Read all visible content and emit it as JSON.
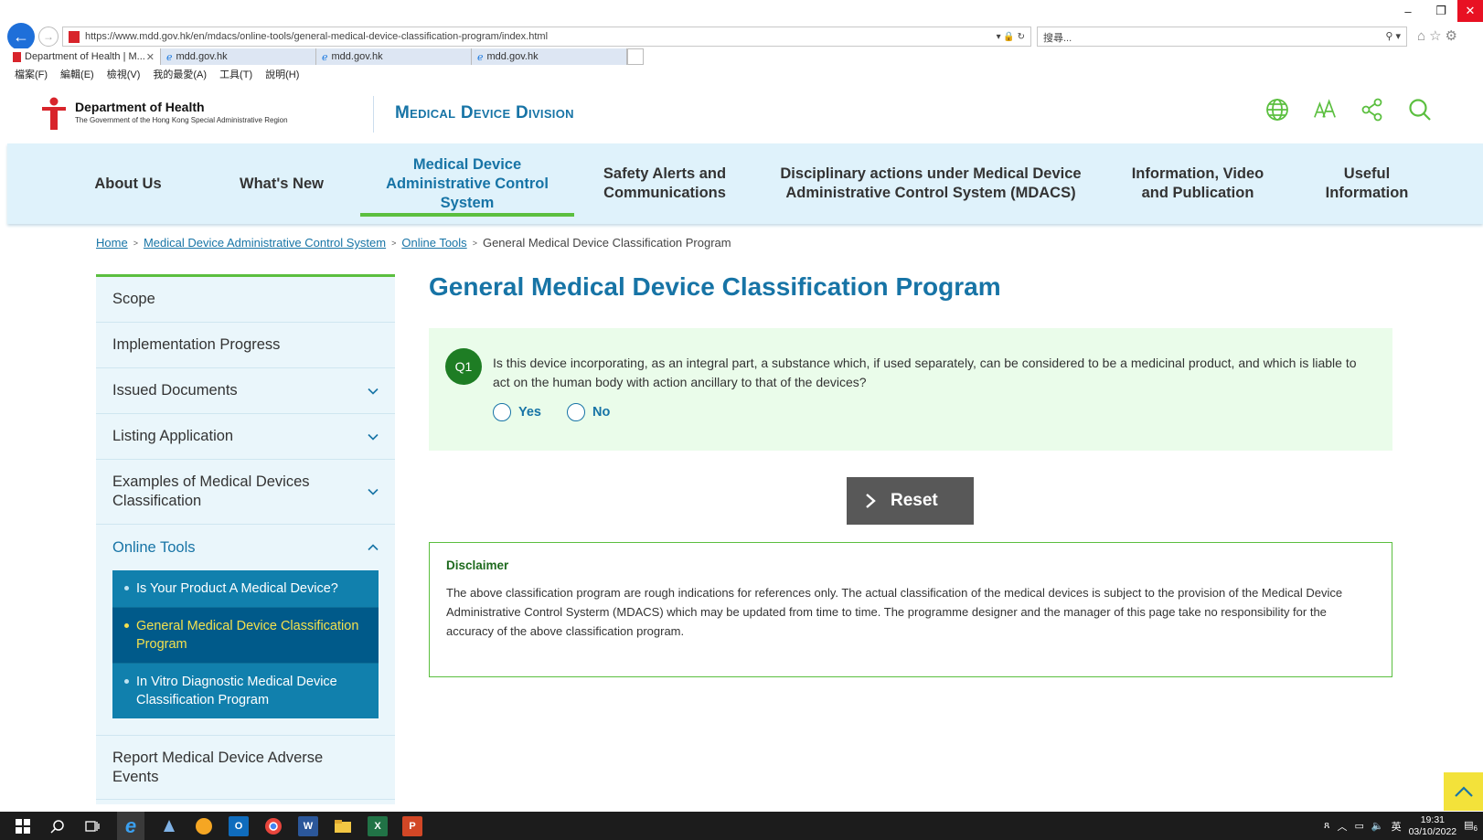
{
  "browser": {
    "url": "https://www.mdd.gov.hk/en/mdacs/online-tools/general-medical-device-classification-program/index.html",
    "search_placeholder": "搜尋...",
    "tabs": [
      {
        "label": "Department of Health | M..."
      },
      {
        "label": "mdd.gov.hk"
      },
      {
        "label": "mdd.gov.hk"
      },
      {
        "label": "mdd.gov.hk"
      }
    ],
    "menu": [
      "檔案(F)",
      "編輯(E)",
      "檢視(V)",
      "我的最愛(A)",
      "工具(T)",
      "說明(H)"
    ]
  },
  "header": {
    "org_name": "Department of Health",
    "org_sub": "The Government of the Hong Kong Special Administrative Region",
    "division": "Medical Device Division"
  },
  "nav": {
    "items": [
      {
        "label": "About Us"
      },
      {
        "label": "What's New"
      },
      {
        "label": "Medical Device Administrative Control System"
      },
      {
        "label": "Safety Alerts and Communications"
      },
      {
        "label": "Disciplinary actions under Medical Device Administrative Control System (MDACS)"
      },
      {
        "label": "Information, Video and Publication"
      },
      {
        "label": "Useful Information"
      }
    ]
  },
  "breadcrumb": {
    "home": "Home",
    "level1": "Medical Device Administrative Control System",
    "level2": "Online Tools",
    "current": "General Medical Device Classification Program"
  },
  "sidebar": {
    "items": [
      {
        "label": "Scope"
      },
      {
        "label": "Implementation Progress"
      },
      {
        "label": "Issued Documents"
      },
      {
        "label": "Listing Application"
      },
      {
        "label": "Examples of Medical Devices Classification"
      },
      {
        "label": "Online Tools"
      },
      {
        "label": "Report Medical Device Adverse Events"
      }
    ],
    "subitems": [
      {
        "label": "Is Your Product A Medical Device?"
      },
      {
        "label": "General Medical Device Classification Program"
      },
      {
        "label": "In Vitro Diagnostic Medical Device Classification Program"
      }
    ]
  },
  "main": {
    "title": "General Medical Device Classification Program",
    "question": {
      "number": "Q1",
      "text": "Is this device incorporating, as an integral part, a substance which, if used separately, can be considered to be a medicinal product, and which is liable to act on the human body with action ancillary to that of the devices?",
      "yes_label": "Yes",
      "no_label": "No"
    },
    "reset_label": "Reset",
    "disclaimer_title": "Disclaimer",
    "disclaimer_text": "The above classification program are rough indications for references only. The actual classification of the medical devices is subject to the provision of the Medical Device Administrative Control Systerm (MDACS) which may be updated from time to time. The programme designer and the manager of this page take no responsibility for the accuracy of the above classification program."
  },
  "taskbar": {
    "ime": "英",
    "time": "19:31",
    "date": "03/10/2022",
    "notif_count": "6"
  },
  "colors": {
    "accent": "#1774a6",
    "green": "#5bbf3f",
    "nav_bg": "#dff2fb",
    "question_bg": "#eafcea"
  }
}
